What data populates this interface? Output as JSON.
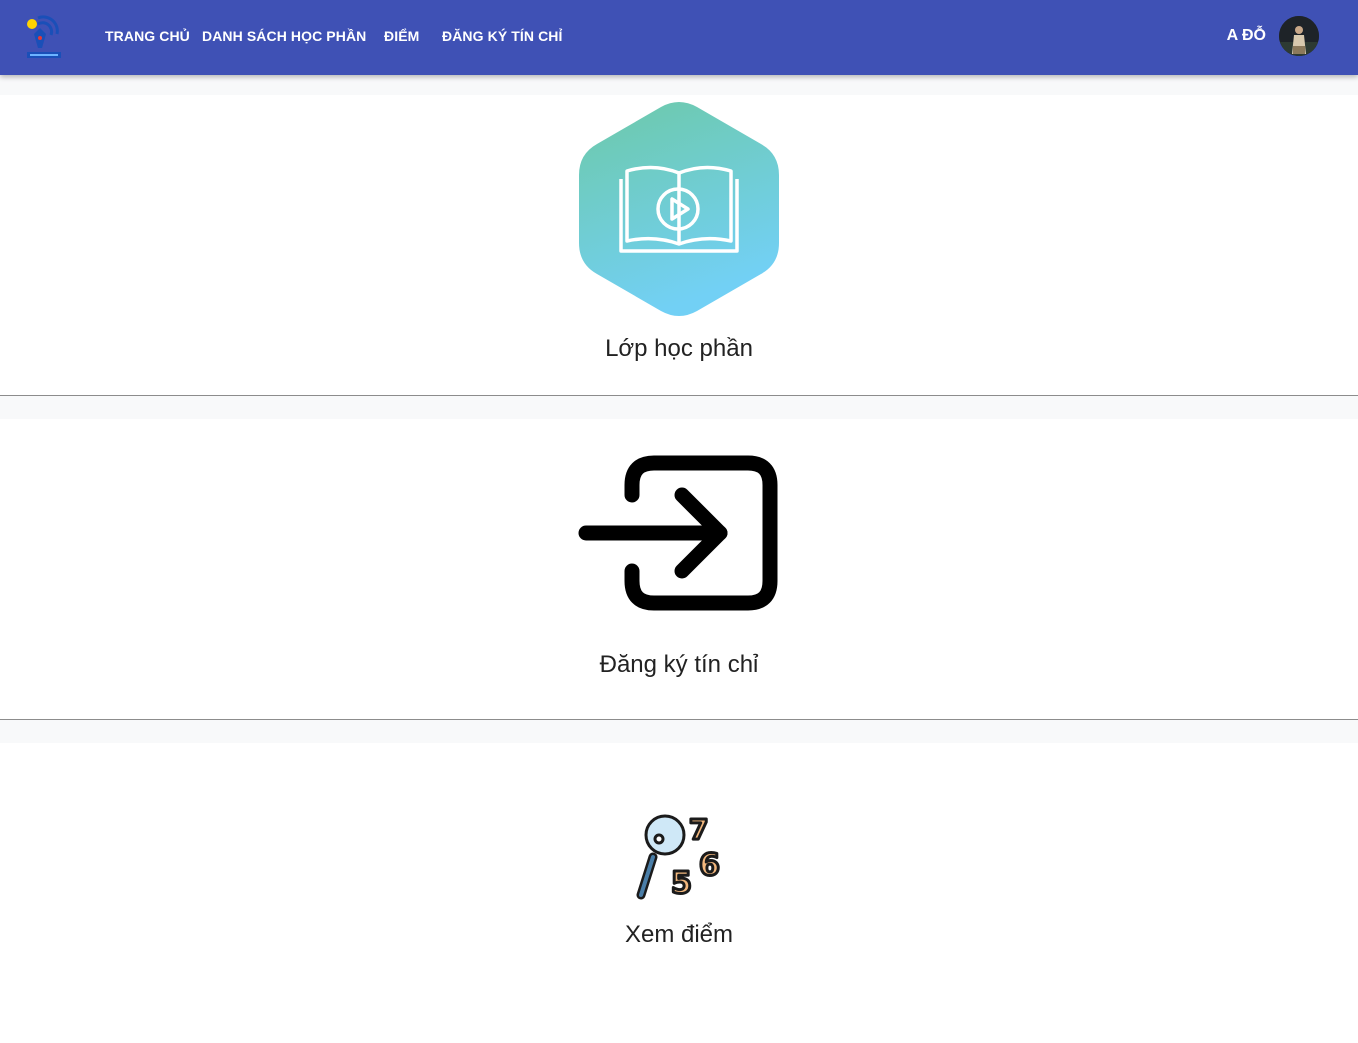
{
  "header": {
    "nav": [
      "TRANG CHỦ",
      "DANH SÁCH HỌC PHẦN",
      "ĐIỂM",
      "ĐĂNG KÝ TÍN CHỈ"
    ],
    "user_name": "A ĐỖ"
  },
  "cards": [
    {
      "label": "Lớp học phần",
      "icon": "open-book-play-icon"
    },
    {
      "label": "Đăng ký tín chỉ",
      "icon": "enter-arrow-icon"
    },
    {
      "label": "Xem điểm",
      "icon": "magnifier-numbers-icon"
    }
  ],
  "colors": {
    "header_bg": "#3f51b5",
    "header_text": "#ffffff",
    "hexagon_gradient_top": "#6dc9a8",
    "hexagon_gradient_bottom": "#72d0f5",
    "page_bg": "#f8f9fa",
    "card_text": "#222222"
  }
}
